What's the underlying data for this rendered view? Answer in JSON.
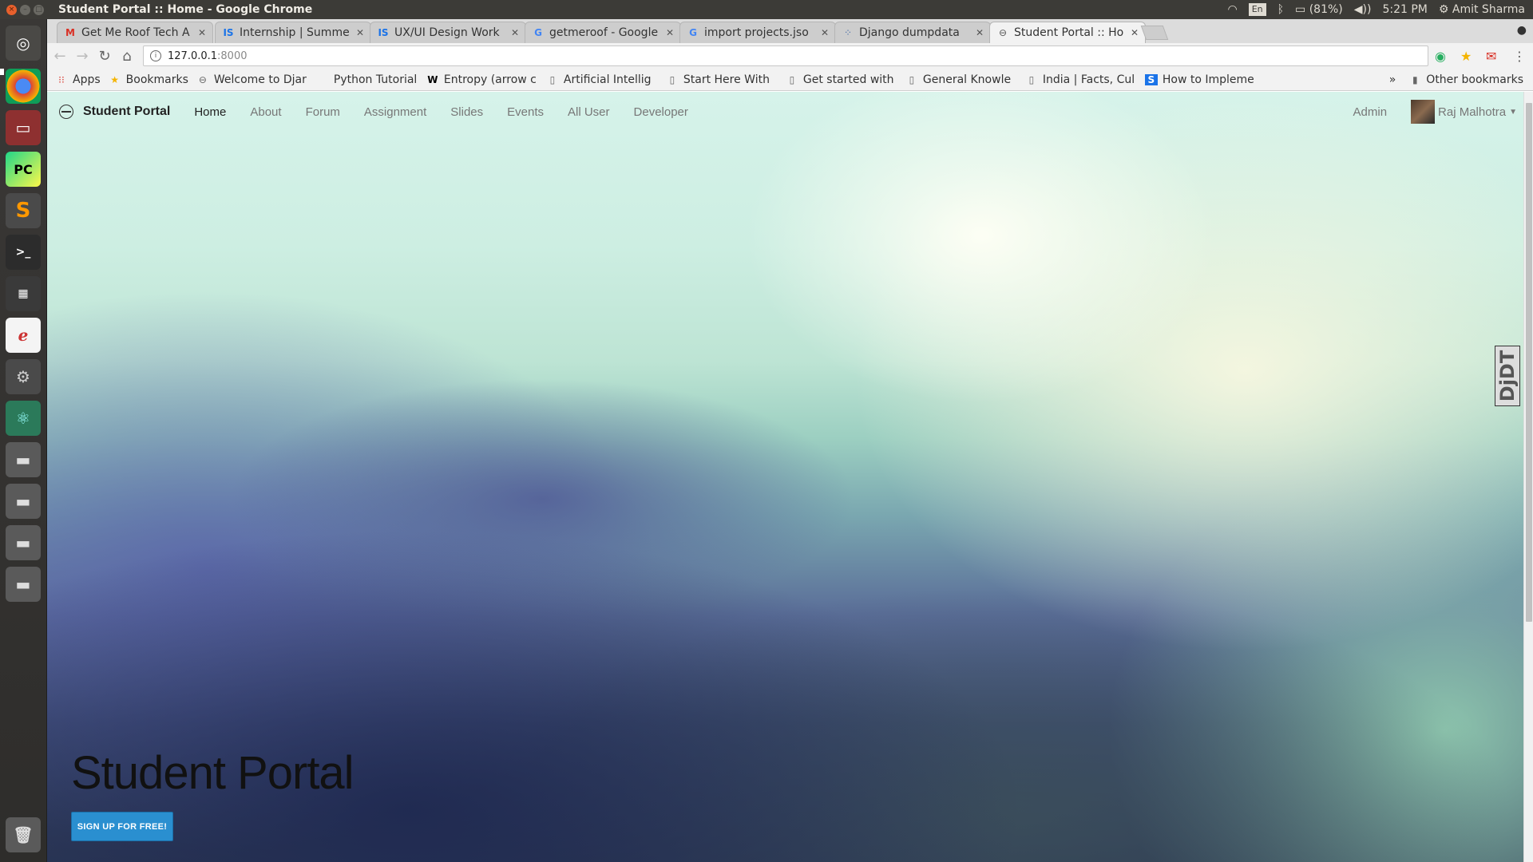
{
  "top_panel": {
    "window_title": "Student Portal :: Home - Google Chrome",
    "keyboard": "En",
    "battery": "(81%)",
    "time": "5:21 PM",
    "user": "Amit Sharma"
  },
  "tabs": [
    {
      "title": "Get Me Roof Tech A",
      "favicon": "gmail-icon"
    },
    {
      "title": "Internship | Summe",
      "favicon": "is-icon"
    },
    {
      "title": "UX/UI Design Work",
      "favicon": "is-icon"
    },
    {
      "title": "getmeroof - Google",
      "favicon": "google-icon"
    },
    {
      "title": "import projects.jso",
      "favicon": "google-icon"
    },
    {
      "title": "Django dumpdata",
      "favicon": "page-icon"
    },
    {
      "title": "Student Portal :: Ho",
      "favicon": "globe-icon"
    }
  ],
  "omnibox": {
    "host": "127.0.0.1",
    "port": ":8000"
  },
  "bookmarks": {
    "apps": "Apps",
    "items": [
      "Bookmarks",
      "Welcome to Djar",
      "Python Tutorial:",
      "Entropy (arrow c",
      "Artificial Intellig",
      "Start Here With",
      "Get started with",
      "General Knowle",
      "India | Facts, Cul",
      "How to Impleme"
    ],
    "overflow": "»",
    "other": "Other bookmarks"
  },
  "site": {
    "brand": "Student Portal",
    "nav": [
      "Home",
      "About",
      "Forum",
      "Assignment",
      "Slides",
      "Events",
      "All User",
      "Developer"
    ],
    "admin": "Admin",
    "user_name": "Raj Malhotra",
    "hero_title": "Student Portal",
    "signup_label": "SIGN UP FOR FREE!",
    "djdt": "DjDT"
  },
  "colors": {
    "accent": "#2a8fd0"
  }
}
